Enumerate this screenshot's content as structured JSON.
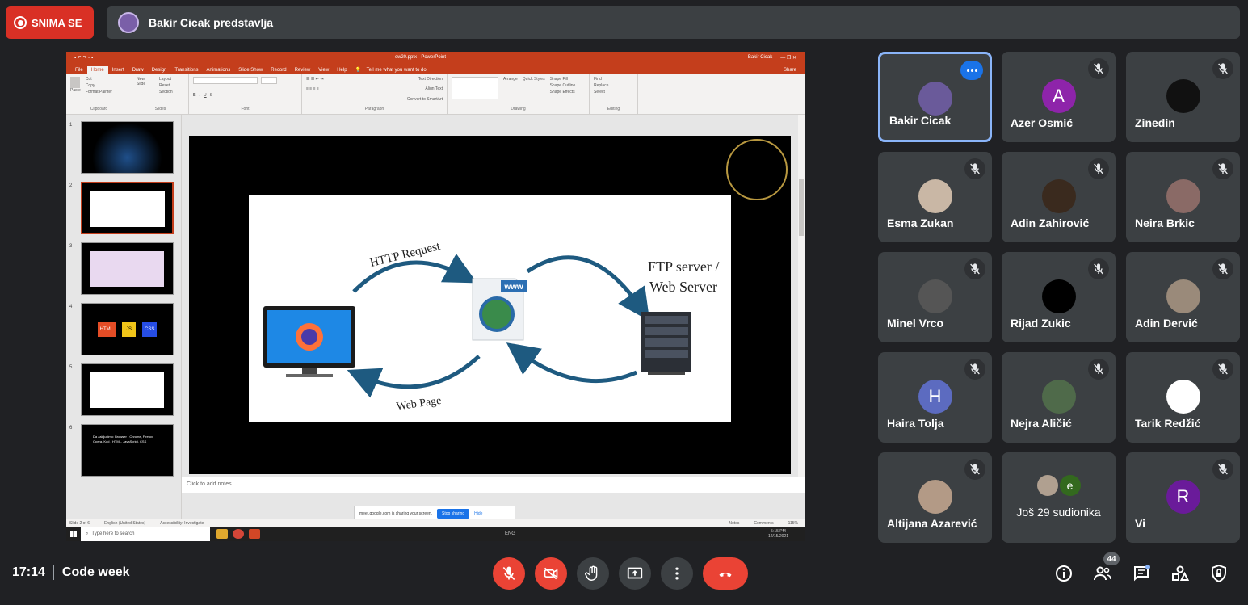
{
  "recording": {
    "label": "SNIMA SE",
    "color": "#d93025"
  },
  "presenter": {
    "text": "Bakir Cicak predstavlja"
  },
  "powerpoint": {
    "title": "cw20.pptx  -  PowerPoint",
    "user": "Bakir Cicak",
    "tabs": [
      "File",
      "Home",
      "Insert",
      "Draw",
      "Design",
      "Transitions",
      "Animations",
      "Slide Show",
      "Record",
      "Review",
      "View",
      "Help"
    ],
    "active_tab": "Home",
    "tell_me": "Tell me what you want to do",
    "share": "Share",
    "ribbon_groups": [
      "Clipboard",
      "Slides",
      "Font",
      "Paragraph",
      "Drawing",
      "Editing"
    ],
    "ribbon_items": {
      "paste": "Paste",
      "cut": "Cut",
      "copy": "Copy",
      "format_painter": "Format Painter",
      "new_slide": "New Slide",
      "layout": "Layout",
      "reset": "Reset",
      "section": "Section",
      "text_direction": "Text Direction",
      "align_text": "Align Text",
      "convert_smartart": "Convert to SmartArt",
      "arrange": "Arrange",
      "quick_styles": "Quick Styles",
      "shape_fill": "Shape Fill",
      "shape_outline": "Shape Outline",
      "shape_effects": "Shape Effects",
      "find": "Find",
      "replace": "Replace",
      "select": "Select"
    },
    "thumbnails": [
      {
        "num": "1"
      },
      {
        "num": "2"
      },
      {
        "num": "3"
      },
      {
        "num": "4"
      },
      {
        "num": "5"
      },
      {
        "num": "6"
      }
    ],
    "slide6_text": "Da zaključimo: Browser - Chrome, Firefox, Opera, Kod - HTML, JavaScript, CSS",
    "slide4_labels": [
      "HTML",
      "JS",
      "CSS"
    ],
    "slide": {
      "http_request": "HTTP Request",
      "web_page": "Web Page",
      "ftp_server_line1": "FTP server /",
      "ftp_server_line2": "Web Server",
      "www": "www"
    },
    "notes_placeholder": "Click to add notes",
    "status": {
      "slide_of": "Slide 2 of 6",
      "language": "English (United States)",
      "accessibility": "Accessibility: Investigate",
      "notes": "Notes",
      "comments": "Comments",
      "zoom": "115%"
    },
    "share_notice": {
      "text": "meet.google.com is sharing your screen.",
      "stop": "Stop sharing",
      "hide": "Hide"
    },
    "taskbar": {
      "search_placeholder": "Type here to search",
      "lang": "ENG",
      "time": "5:15 PM",
      "date": "12/15/2021"
    }
  },
  "participants": [
    {
      "name": "Bakir Cicak",
      "avatar_type": "photo",
      "avatar_color": "#6a5a9a",
      "active": true
    },
    {
      "name": "Azer Osmić",
      "avatar_type": "letter",
      "letter": "A",
      "avatar_color": "#8e24aa"
    },
    {
      "name": "Zinedin",
      "avatar_type": "photo",
      "avatar_color": "#111111"
    },
    {
      "name": "Esma Zukan",
      "avatar_type": "photo",
      "avatar_color": "#c9b7a5"
    },
    {
      "name": "Adin Zahirović",
      "avatar_type": "photo",
      "avatar_color": "#3a2a1e"
    },
    {
      "name": "Neira Brkic",
      "avatar_type": "photo",
      "avatar_color": "#8a6a66"
    },
    {
      "name": "Minel Vrco",
      "avatar_type": "photo",
      "avatar_color": "#555555"
    },
    {
      "name": "Rijad Zukic",
      "avatar_type": "photo",
      "avatar_color": "#000000"
    },
    {
      "name": "Adin Dervić",
      "avatar_type": "photo",
      "avatar_color": "#9a8a7a"
    },
    {
      "name": "Haira Tolja",
      "avatar_type": "letter",
      "letter": "H",
      "avatar_color": "#5c6bc0"
    },
    {
      "name": "Nejra Aličić",
      "avatar_type": "photo",
      "avatar_color": "#4f6a4a"
    },
    {
      "name": "Tarik Redžić",
      "avatar_type": "photo",
      "avatar_color": "#ffffff"
    },
    {
      "name": "Altijana Azarević",
      "avatar_type": "photo",
      "avatar_color": "#b39a86"
    },
    {
      "name": "Još 29 sudionika",
      "avatar_type": "group",
      "letter": "e",
      "avatar_color": "#33691e"
    },
    {
      "name": "Vi",
      "avatar_type": "letter",
      "letter": "R",
      "avatar_color": "#6a1b9a"
    }
  ],
  "meeting": {
    "time": "17:14",
    "name": "Code week",
    "participant_count": "44"
  },
  "colors": {
    "accent": "#8ab4f8",
    "danger": "#ea4335",
    "tile_bg": "#3c4043",
    "bg": "#202124"
  }
}
